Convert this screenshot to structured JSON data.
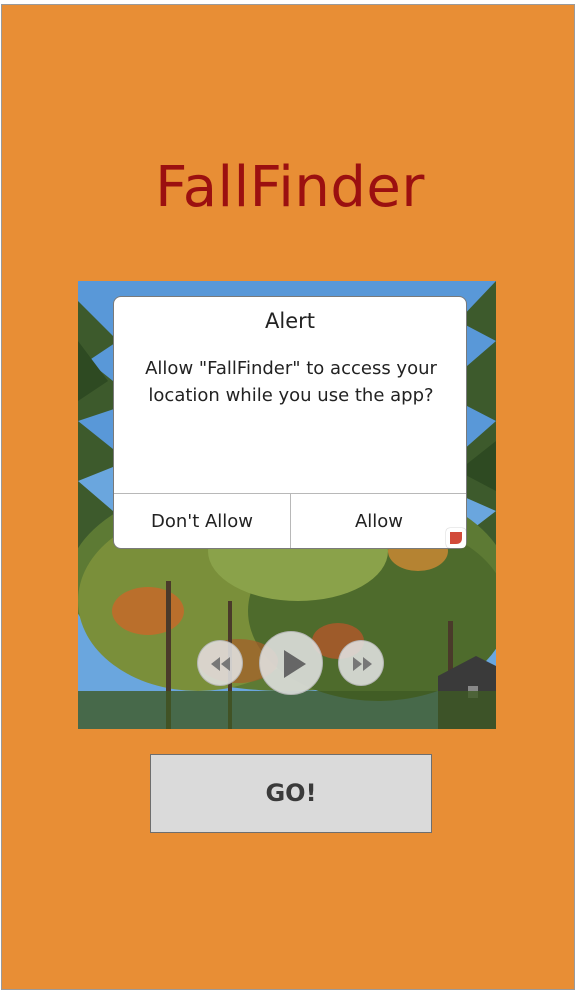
{
  "app": {
    "title": "FallFinder"
  },
  "alert": {
    "title": "Alert",
    "message": "Allow \"FallFinder\" to access your location while you use the app?",
    "deny_label": "Don't Allow",
    "allow_label": "Allow"
  },
  "media": {
    "rewind_icon": "rewind-icon",
    "play_icon": "play-icon",
    "forward_icon": "fast-forward-icon"
  },
  "actions": {
    "go_label": "GO!"
  },
  "colors": {
    "background": "#e88e35",
    "title": "#9b1010",
    "button": "#dadada"
  }
}
